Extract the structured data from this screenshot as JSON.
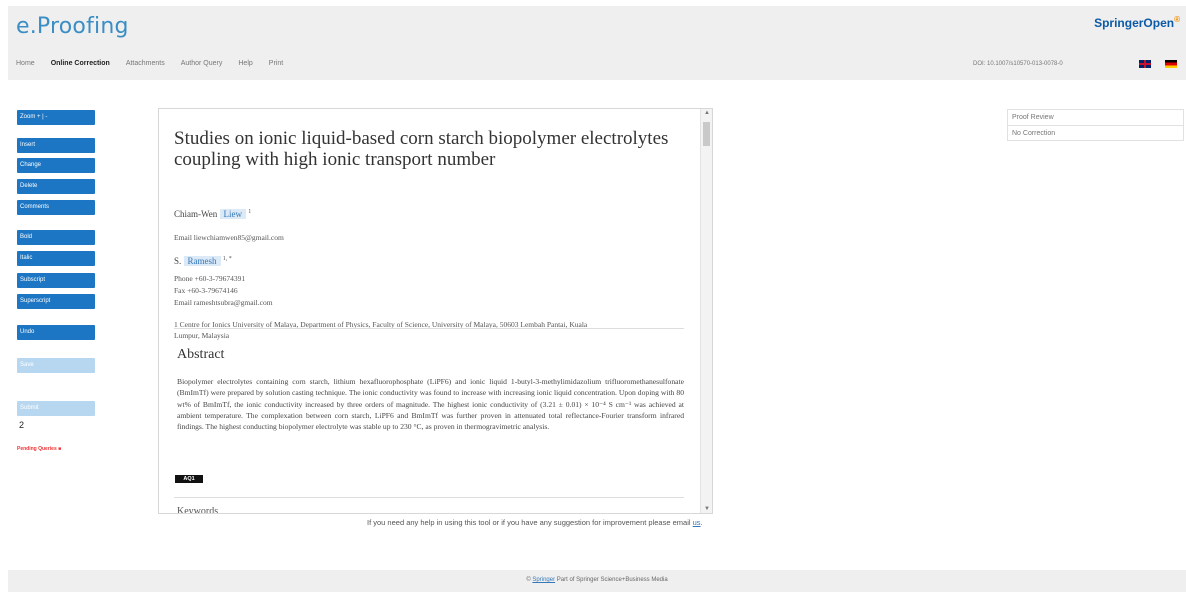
{
  "header": {
    "logo": "e.Proofing",
    "brand": "SpringerOpen",
    "brand_mark": "®",
    "nav": [
      "Home",
      "Online Correction",
      "Attachments",
      "Author Query",
      "Help",
      "Print"
    ],
    "doi": "DOI: 10.1007/s10570-013-0078-0"
  },
  "toolbar": {
    "zoom": "Zoom + | -",
    "buttons": [
      "Insert",
      "Change",
      "Delete",
      "Comments",
      "Bold",
      "Italic",
      "Subscript",
      "Superscript",
      "Undo",
      "Save",
      "Submit"
    ],
    "page_number": "2",
    "pending_queries": "Pending Queries ■"
  },
  "document": {
    "title": "Studies on ionic liquid-based corn starch biopolymer electrolytes coupling with high ionic transport number",
    "author1": {
      "given": "Chiam-Wen",
      "surname": "Liew",
      "affil": "1",
      "email": "Email liewchiamwen85@gmail.com"
    },
    "author2": {
      "given": "S.",
      "surname": "Ramesh",
      "affil": "1, *",
      "phone": "Phone +60-3-79674391",
      "fax": "Fax +60-3-79674146",
      "email": "Email rameshtsubra@gmail.com"
    },
    "affiliation": "1 Centre for Ionics University of Malaya, Department of Physics, Faculty of Science, University of Malaya, 50603 Lembah Pantai, Kuala Lumpur, Malaysia",
    "abstract_title": "Abstract",
    "abstract_text": "Biopolymer electrolytes containing corn starch, lithium hexafluorophosphate (LiPF6) and ionic liquid 1-butyl-3-methylimidazolium trifluoromethanesulfonate (BmImTf) were prepared by solution casting technique. The ionic conductivity was found to increase with increasing ionic liquid concentration. Upon doping with 80 wt% of BmImTf, the ionic conductivity increased by three orders of magnitude. The highest ionic conductivity of (3.21 ± 0.01) × 10⁻⁴ S cm⁻¹ was achieved at ambient temperature. The complexation between corn starch, LiPF6 and BmImTf was further proven in attenuated total reflectance-Fourier transform infrared findings. The highest conducting biopolymer electrolyte was stable up to 230 °C, as proven in thermogravimetric analysis.",
    "aq_badge": "AQ1",
    "keywords_title": "Keywords"
  },
  "proof_review": {
    "title": "Proof Review",
    "status": "No Correction"
  },
  "help": {
    "text": "If you need any help in using this tool or if you have any suggestion for improvement please email",
    "link": "us"
  },
  "footer": {
    "prefix": "© ",
    "link": "Springer",
    "text": " Part of Springer Science+Business Media"
  }
}
